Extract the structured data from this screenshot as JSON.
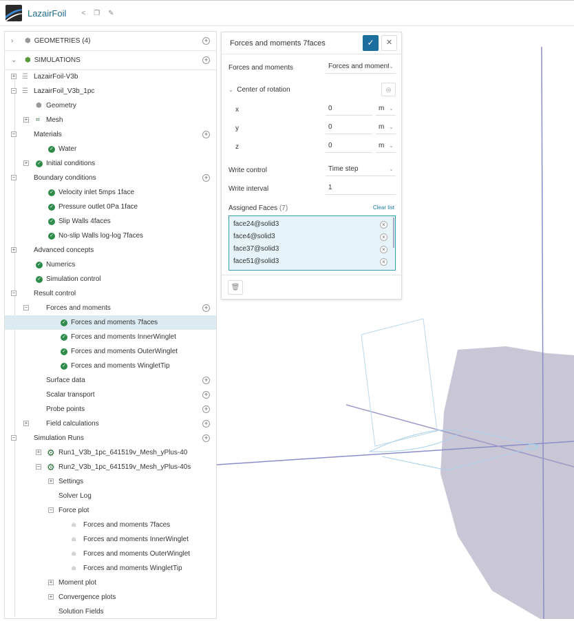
{
  "header": {
    "title": "LazairFoil",
    "icons": [
      "share-icon",
      "copy-icon",
      "edit-icon"
    ]
  },
  "sections": {
    "geometries": "GEOMETRIES (4)",
    "simulations": "SIMULATIONS"
  },
  "tree": [
    {
      "label": "LazairFoil-V3b",
      "depth": 0,
      "toggle": "+",
      "icon": "sim"
    },
    {
      "label": "LazairFoil_V3b_1pc",
      "depth": 0,
      "toggle": "-",
      "icon": "sim"
    },
    {
      "label": "Geometry",
      "depth": 1,
      "icon": "geo"
    },
    {
      "label": "Mesh",
      "depth": 1,
      "toggle": "+",
      "icon": "mesh"
    },
    {
      "label": "Materials",
      "depth": 0,
      "toggle": "-",
      "plus": true
    },
    {
      "label": "Water",
      "depth": 2,
      "icon": "check"
    },
    {
      "label": "Initial conditions",
      "depth": 1,
      "toggle": "+",
      "icon": "check"
    },
    {
      "label": "Boundary conditions",
      "depth": 0,
      "toggle": "-",
      "plus": true
    },
    {
      "label": "Velocity inlet 5mps 1face",
      "depth": 2,
      "icon": "check"
    },
    {
      "label": "Pressure outlet 0Pa 1face",
      "depth": 2,
      "icon": "check"
    },
    {
      "label": "Slip Walls 4faces",
      "depth": 2,
      "icon": "check"
    },
    {
      "label": "No-slip Walls log-log 7faces",
      "depth": 2,
      "icon": "check"
    },
    {
      "label": "Advanced concepts",
      "depth": 0,
      "toggle": "+"
    },
    {
      "label": "Numerics",
      "depth": 1,
      "icon": "check"
    },
    {
      "label": "Simulation control",
      "depth": 1,
      "icon": "check"
    },
    {
      "label": "Result control",
      "depth": 0,
      "toggle": "-"
    },
    {
      "label": "Forces and moments",
      "depth": 1,
      "toggle": "-",
      "plus": true
    },
    {
      "label": "Forces and moments 7faces",
      "depth": 3,
      "icon": "check",
      "selected": true
    },
    {
      "label": "Forces and moments InnerWinglet",
      "depth": 3,
      "icon": "check"
    },
    {
      "label": "Forces and moments OuterWinglet",
      "depth": 3,
      "icon": "check"
    },
    {
      "label": "Forces and moments WingletTip",
      "depth": 3,
      "icon": "check"
    },
    {
      "label": "Surface data",
      "depth": 1,
      "plus": true
    },
    {
      "label": "Scalar transport",
      "depth": 1,
      "plus": true
    },
    {
      "label": "Probe points",
      "depth": 1,
      "plus": true
    },
    {
      "label": "Field calculations",
      "depth": 1,
      "toggle": "+",
      "plus": true
    },
    {
      "label": "Simulation Runs",
      "depth": 0,
      "toggle": "-",
      "plus": true
    },
    {
      "label": "Run1_V3b_1pc_641519v_Mesh_yPlus-40",
      "depth": 2,
      "toggle": "+",
      "icon": "gear"
    },
    {
      "label": "Run2_V3b_1pc_641519v_Mesh_yPlus-40s",
      "depth": 2,
      "toggle": "-",
      "icon": "gear"
    },
    {
      "label": "Settings",
      "depth": 2,
      "toggle": "+"
    },
    {
      "label": "Solver Log",
      "depth": 2
    },
    {
      "label": "Force plot",
      "depth": 2,
      "toggle": "-"
    },
    {
      "label": "Forces and moments 7faces",
      "depth": 4,
      "icon": "plot"
    },
    {
      "label": "Forces and moments InnerWinglet",
      "depth": 4,
      "icon": "plot"
    },
    {
      "label": "Forces and moments OuterWinglet",
      "depth": 4,
      "icon": "plot"
    },
    {
      "label": "Forces and moments WingletTip",
      "depth": 4,
      "icon": "plot"
    },
    {
      "label": "Moment plot",
      "depth": 2,
      "toggle": "+"
    },
    {
      "label": "Convergence plots",
      "depth": 2,
      "toggle": "+"
    },
    {
      "label": "Solution Fields",
      "depth": 2
    }
  ],
  "panel": {
    "title": "Forces and moments 7faces",
    "type_label": "Forces and moments",
    "type_value": "Forces and moments",
    "center_label": "Center of rotation",
    "coords": [
      {
        "axis": "x",
        "value": "0",
        "unit": "m"
      },
      {
        "axis": "y",
        "value": "0",
        "unit": "m"
      },
      {
        "axis": "z",
        "value": "0",
        "unit": "m"
      }
    ],
    "write_control_label": "Write control",
    "write_control_value": "Time step",
    "write_interval_label": "Write interval",
    "write_interval_value": "1",
    "assigned_label": "Assigned Faces",
    "assigned_count": "(7)",
    "clear_list": "Clear list",
    "faces": [
      "face24@solid3",
      "face4@solid3",
      "face37@solid3",
      "face51@solid3"
    ]
  }
}
